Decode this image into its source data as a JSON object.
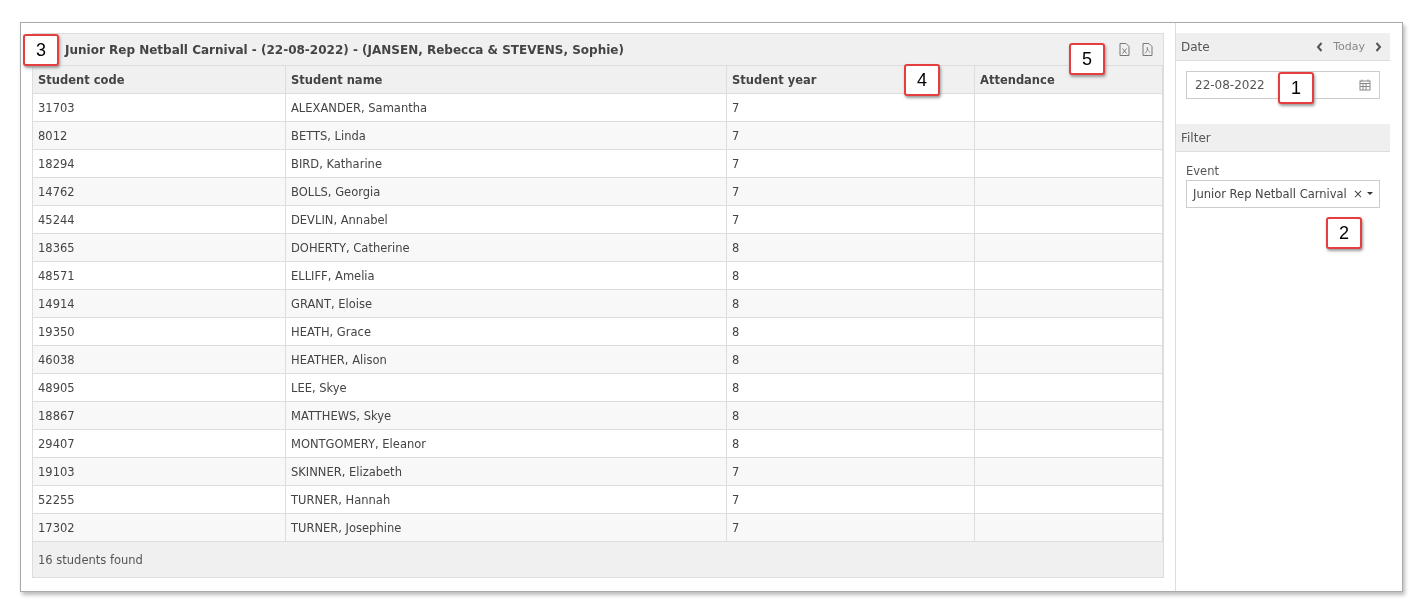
{
  "panel": {
    "title": "Junior Rep Netball Carnival - (22-08-2022) - (JANSEN, Rebecca & STEVENS, Sophie)"
  },
  "table": {
    "columns": [
      "Student code",
      "Student name",
      "Student year",
      "Attendance"
    ],
    "rows": [
      [
        "31703",
        "ALEXANDER, Samantha",
        "7",
        ""
      ],
      [
        "8012",
        "BETTS, Linda",
        "7",
        ""
      ],
      [
        "18294",
        "BIRD, Katharine",
        "7",
        ""
      ],
      [
        "14762",
        "BOLLS, Georgia",
        "7",
        ""
      ],
      [
        "45244",
        "DEVLIN, Annabel",
        "7",
        ""
      ],
      [
        "18365",
        "DOHERTY, Catherine",
        "8",
        ""
      ],
      [
        "48571",
        "ELLIFF, Amelia",
        "8",
        ""
      ],
      [
        "14914",
        "GRANT, Eloise",
        "8",
        ""
      ],
      [
        "19350",
        "HEATH, Grace",
        "8",
        ""
      ],
      [
        "46038",
        "HEATHER, Alison",
        "8",
        ""
      ],
      [
        "48905",
        "LEE, Skye",
        "8",
        ""
      ],
      [
        "18867",
        "MATTHEWS, Skye",
        "8",
        ""
      ],
      [
        "29407",
        "MONTGOMERY, Eleanor",
        "8",
        ""
      ],
      [
        "19103",
        "SKINNER, Elizabeth",
        "7",
        ""
      ],
      [
        "52255",
        "TURNER, Hannah",
        "7",
        ""
      ],
      [
        "17302",
        "TURNER, Josephine",
        "7",
        ""
      ]
    ],
    "footer": "16 students found"
  },
  "sidebar": {
    "date": {
      "heading": "Date",
      "today": "Today",
      "value": "22-08-2022"
    },
    "filter": {
      "heading": "Filter",
      "event_label": "Event",
      "event_value": "Junior Rep Netball Carnival",
      "clear": "×"
    }
  },
  "callouts": [
    "3",
    "5",
    "4",
    "1",
    "2"
  ]
}
